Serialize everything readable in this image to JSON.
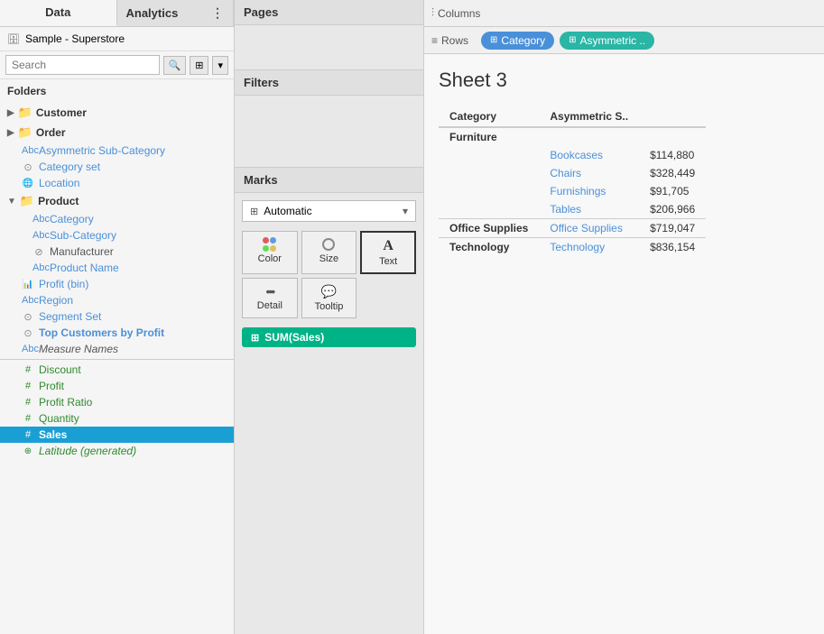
{
  "tabs": {
    "data_label": "Data",
    "analytics_label": "Analytics"
  },
  "datasource": {
    "label": "Sample - Superstore"
  },
  "search": {
    "placeholder": "Search"
  },
  "folders": {
    "label": "Folders"
  },
  "groups": [
    {
      "name": "customer-group",
      "label": "Customer",
      "icon": "folder",
      "expanded": false,
      "items": []
    },
    {
      "name": "order-group",
      "label": "Order",
      "icon": "folder",
      "expanded": false,
      "items": []
    }
  ],
  "fields": [
    {
      "name": "asymmetric-sub-category",
      "label": "Asymmetric Sub-Category",
      "icon": "Abc",
      "type": "dim",
      "indent": 1
    },
    {
      "name": "category-set",
      "label": "Category set",
      "icon": "set",
      "type": "set",
      "indent": 1
    },
    {
      "name": "location",
      "label": "Location",
      "icon": "loc",
      "type": "dim",
      "indent": 1
    },
    {
      "name": "product-group",
      "label": "Product",
      "icon": "folder",
      "type": "folder",
      "indent": 1,
      "expanded": true
    },
    {
      "name": "category",
      "label": "Category",
      "icon": "Abc",
      "type": "dim",
      "indent": 2
    },
    {
      "name": "sub-category",
      "label": "Sub-Category",
      "icon": "Abc",
      "type": "dim",
      "indent": 2
    },
    {
      "name": "manufacturer",
      "label": "Manufacturer",
      "icon": "link",
      "type": "dim",
      "indent": 2
    },
    {
      "name": "product-name",
      "label": "Product Name",
      "icon": "Abc",
      "type": "dim",
      "indent": 2
    },
    {
      "name": "profit-bin",
      "label": "Profit (bin)",
      "icon": "bin",
      "type": "dim",
      "indent": 1
    },
    {
      "name": "region",
      "label": "Region",
      "icon": "Abc",
      "type": "dim",
      "indent": 1
    },
    {
      "name": "segment-set",
      "label": "Segment Set",
      "icon": "set",
      "type": "set",
      "indent": 1
    },
    {
      "name": "top-customers",
      "label": "Top Customers by Profit",
      "icon": "set",
      "type": "set-blue",
      "indent": 1
    },
    {
      "name": "measure-names",
      "label": "Measure Names",
      "icon": "Abc",
      "type": "measure-names",
      "indent": 1
    },
    {
      "name": "discount",
      "label": "Discount",
      "icon": "#",
      "type": "mea",
      "indent": 1
    },
    {
      "name": "profit",
      "label": "Profit",
      "icon": "#",
      "type": "mea",
      "indent": 1
    },
    {
      "name": "profit-ratio",
      "label": "Profit Ratio",
      "icon": "#",
      "type": "mea",
      "indent": 1
    },
    {
      "name": "quantity",
      "label": "Quantity",
      "icon": "#",
      "type": "mea",
      "indent": 1
    },
    {
      "name": "sales",
      "label": "Sales",
      "icon": "#",
      "type": "mea",
      "indent": 1,
      "selected": true
    },
    {
      "name": "latitude",
      "label": "Latitude (generated)",
      "icon": "geo",
      "type": "geo",
      "indent": 1
    }
  ],
  "pages": {
    "label": "Pages"
  },
  "filters": {
    "label": "Filters"
  },
  "marks": {
    "label": "Marks",
    "dropdown": "Automatic",
    "dropdown_icon": "⊞",
    "buttons": [
      {
        "name": "color-btn",
        "label": "Color",
        "icon": "⬤⬤\n⬤⬤"
      },
      {
        "name": "size-btn",
        "label": "Size",
        "icon": "◯"
      },
      {
        "name": "text-btn",
        "label": "Text",
        "icon": "A",
        "selected": true
      },
      {
        "name": "detail-btn",
        "label": "Detail",
        "icon": "•••"
      },
      {
        "name": "tooltip-btn",
        "label": "Tooltip",
        "icon": "💬"
      }
    ],
    "pill_label": "SUM(Sales)",
    "pill_icon": "⊞"
  },
  "columns": {
    "label": "Columns",
    "icon": "⫶"
  },
  "rows": {
    "label": "Rows",
    "icon": "≡",
    "pills": [
      {
        "name": "category-pill",
        "label": "Category",
        "color": "blue"
      },
      {
        "name": "asymmetric-pill",
        "label": "Asymmetric ..",
        "color": "teal"
      }
    ]
  },
  "sheet": {
    "title": "Sheet 3",
    "table": {
      "headers": [
        "Category",
        "Asymmetric S.."
      ],
      "rows": [
        {
          "category": "Furniture",
          "subcategory": "",
          "value": "",
          "is_category": true
        },
        {
          "category": "",
          "subcategory": "Bookcases",
          "value": "$114,880",
          "is_category": false
        },
        {
          "category": "",
          "subcategory": "Chairs",
          "value": "$328,449",
          "is_category": false
        },
        {
          "category": "",
          "subcategory": "Furnishings",
          "value": "$91,705",
          "is_category": false
        },
        {
          "category": "",
          "subcategory": "Tables",
          "value": "$206,966",
          "is_category": false
        },
        {
          "category": "Office Supplies",
          "subcategory": "Office Supplies",
          "value": "$719,047",
          "is_category": true
        },
        {
          "category": "Technology",
          "subcategory": "Technology",
          "value": "$836,154",
          "is_category": true
        }
      ]
    }
  }
}
